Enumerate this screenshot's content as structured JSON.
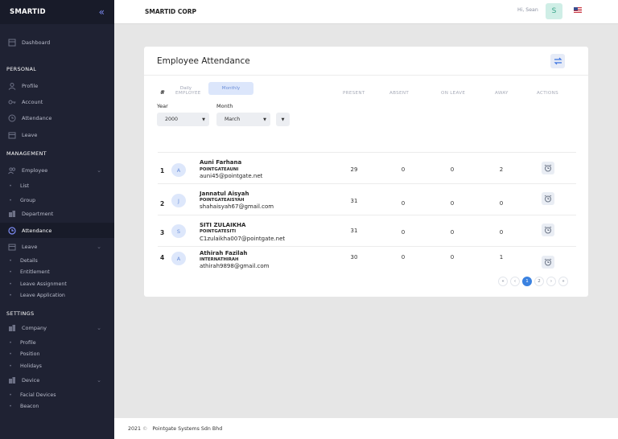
{
  "brand": {
    "name": "SMARTID",
    "collapse_icon": "«"
  },
  "sidebar": {
    "dashboard": "Dashboard",
    "personal_header": "PERSONAL",
    "profile": "Profile",
    "account": "Account",
    "attendance": "Attendance",
    "leave": "Leave",
    "management_header": "MANAGEMENT",
    "employee": "Employee",
    "list": "List",
    "group": "Group",
    "department": "Department",
    "attendance_active": "Attendance",
    "leave_mgmt": "Leave",
    "details": "Details",
    "entitlement": "Entitlement",
    "leave_assignment": "Leave Assignment",
    "leave_application": "Leave Application",
    "settings_header": "SETTINGS",
    "company": "Company",
    "company_profile": "Profile",
    "position": "Position",
    "holidays": "Holidays",
    "device": "Device",
    "facial_devices": "Facial Devices",
    "beacon": "Beacon"
  },
  "topbar": {
    "corp": "SMARTID CORP",
    "greeting": "Hi, Sean",
    "avatar": "S"
  },
  "card": {
    "title": "Employee Attendance",
    "tabs": [
      "Daily",
      "Monthly"
    ],
    "year_label": "Year",
    "year_value": "2000",
    "month_label": "Month",
    "month_value": "March",
    "columns": [
      "#",
      "EMPLOYEE",
      "PRESENT",
      "ABSENT",
      "ON LEAVE",
      "AWAY",
      "ACTIONS"
    ],
    "rows": [
      {
        "n": "1",
        "initial": "A",
        "name": "Auni Farhana",
        "code": "POINTGATEAUNI",
        "email": "auni45@pointgate.net",
        "present": "29",
        "absent": "0",
        "leave": "0",
        "away": "2"
      },
      {
        "n": "2",
        "initial": "J",
        "name": "Jannatul Aisyah",
        "code": "POINTGATEAISYAH",
        "email": "shahaisyah67@gmail.com",
        "present": "31",
        "absent": "0",
        "leave": "0",
        "away": "0"
      },
      {
        "n": "3",
        "initial": "S",
        "name": "SITI ZULAIKHA",
        "code": "POINTGATESITI",
        "email": "C1zulaikha007@pointgate.net",
        "present": "31",
        "absent": "0",
        "leave": "0",
        "away": "0"
      },
      {
        "n": "4",
        "initial": "A",
        "name": "Athirah Fazilah",
        "code": "INTERNATHIRAH",
        "email": "athirah9898@gmail.com",
        "present": "30",
        "absent": "0",
        "leave": "0",
        "away": "1"
      }
    ],
    "pagination": [
      "«",
      "‹",
      "1",
      "2",
      "›",
      "»"
    ]
  },
  "footer": {
    "year": "2021",
    "copyright": "©",
    "company": "Pointgate Systems Sdn Bhd"
  }
}
